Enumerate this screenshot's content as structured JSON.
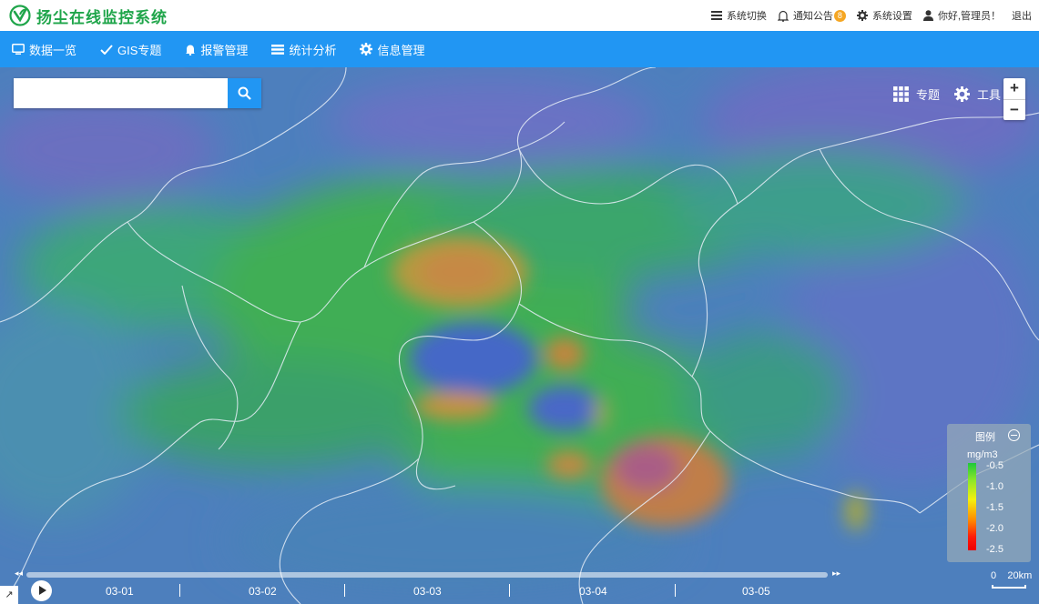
{
  "app": {
    "title": "扬尘在线监控系统",
    "brand_color": "#1fa54a"
  },
  "top_menu": {
    "switch_label": "系统切换",
    "notice_label": "通知公告",
    "notice_count": "8",
    "settings_label": "系统设置",
    "greeting": "你好,管理员！",
    "logout_label": "退出"
  },
  "nav": {
    "bg_color": "#2196f3",
    "items": [
      {
        "label": "数据一览",
        "icon": "monitor-icon"
      },
      {
        "label": "GIS专题",
        "icon": "check-icon"
      },
      {
        "label": "报警管理",
        "icon": "bell-icon"
      },
      {
        "label": "统计分析",
        "icon": "list-icon"
      },
      {
        "label": "信息管理",
        "icon": "gear-icon"
      }
    ]
  },
  "search": {
    "value": "",
    "placeholder": ""
  },
  "map_tools": {
    "topic_label": "专题",
    "tools_label": "工具",
    "zoom_in": "+",
    "zoom_out": "−"
  },
  "legend": {
    "title": "图例",
    "unit": "mg/m3",
    "ticks": [
      "-0.5",
      "-1.0",
      "-1.5",
      "-2.0",
      "-2.5"
    ]
  },
  "scale": {
    "label": "0    20km"
  },
  "timeline": {
    "prev": "◂◂",
    "next": "▸▸",
    "dates": [
      "03-01",
      "03-02",
      "03-03",
      "03-04",
      "03-05"
    ]
  },
  "corner": {
    "label": "↗"
  }
}
